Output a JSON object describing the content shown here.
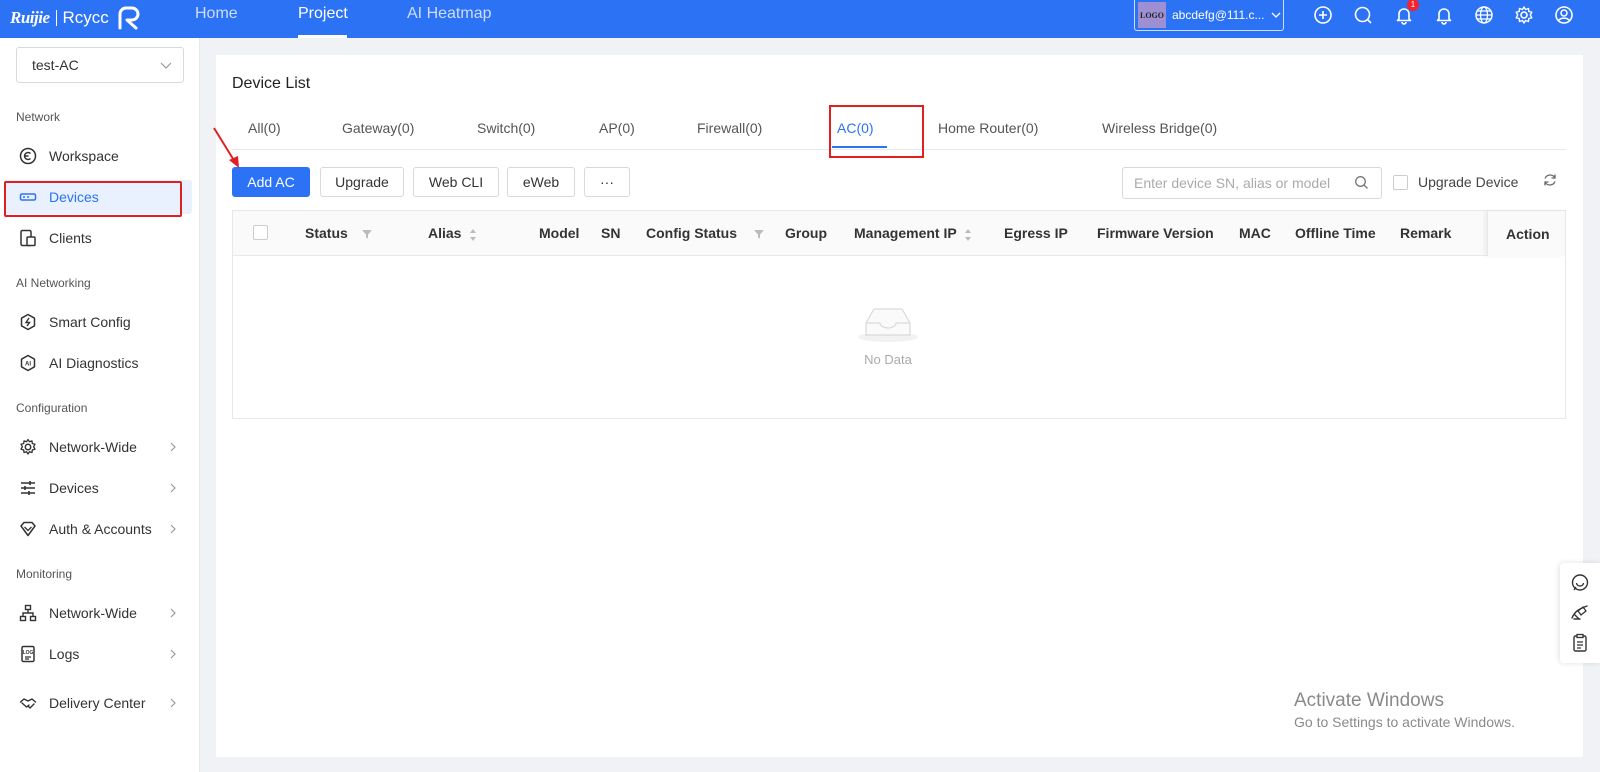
{
  "topbar": {
    "brand": "Ruijie",
    "product": "Rcycc",
    "nav": [
      {
        "label": "Home"
      },
      {
        "label": "Project"
      },
      {
        "label": "AI Heatmap"
      }
    ],
    "account_logo": "LOGO",
    "account_name": "abcdefg@111.c...",
    "notification_badge": "1",
    "icons": [
      "add-circle-icon",
      "search-icon",
      "notification-bell-icon",
      "bell-icon",
      "globe-icon",
      "gear-icon",
      "user-icon"
    ],
    "color": "#2b72f5"
  },
  "sidebar": {
    "project": "test-AC",
    "sections": {
      "network": "Network",
      "ai_networking": "AI Networking",
      "configuration": "Configuration",
      "monitoring": "Monitoring"
    },
    "items": {
      "workspace": "Workspace",
      "devices": "Devices",
      "clients": "Clients",
      "smart_config": "Smart Config",
      "ai_diagnostics": "AI Diagnostics",
      "config_network_wide": "Network-Wide",
      "config_devices": "Devices",
      "auth_accounts": "Auth & Accounts",
      "monitor_network_wide": "Network-Wide",
      "logs": "Logs",
      "delivery_center": "Delivery Center"
    }
  },
  "main": {
    "title": "Device List",
    "tabs": [
      {
        "label": "All(0)"
      },
      {
        "label": "Gateway(0)"
      },
      {
        "label": "Switch(0)"
      },
      {
        "label": "AP(0)"
      },
      {
        "label": "Firewall(0)"
      },
      {
        "label": "AC(0)"
      },
      {
        "label": "Home Router(0)"
      },
      {
        "label": "Wireless Bridge(0)"
      }
    ],
    "active_tab": "AC(0)",
    "toolbar": {
      "add": "Add AC",
      "upgrade": "Upgrade",
      "web_cli": "Web CLI",
      "eweb": "eWeb",
      "more": "···",
      "search_placeholder": "Enter device SN, alias or model",
      "upgrade_device": "Upgrade Device"
    },
    "table": {
      "columns": [
        "Status",
        "Alias",
        "Model",
        "SN",
        "Config Status",
        "Group",
        "Management IP",
        "Egress IP",
        "Firmware Version",
        "MAC",
        "Offline Time",
        "Remark",
        "Action"
      ],
      "empty_text": "No Data"
    }
  },
  "watermark": {
    "line1": "Activate Windows",
    "line2": "Go to Settings to activate Windows."
  }
}
